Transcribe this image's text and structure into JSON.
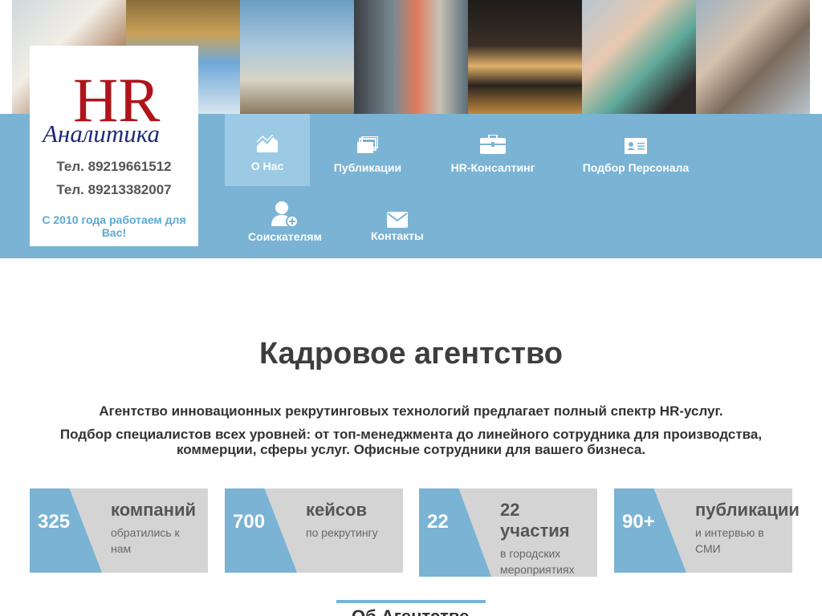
{
  "header": {
    "photos": [
      "office-photo",
      "arch-photo",
      "gate-photo",
      "interview-photo",
      "night-palace-photo",
      "selfie-photo",
      "embankment-photo"
    ]
  },
  "logo": {
    "letters": "HR",
    "word": "Аналитика",
    "brand_color": "#b0131a",
    "script_color": "#1e2b7a"
  },
  "contacts": {
    "phone1": "Тел. 89219661512",
    "phone2": "Тел. 89213382007",
    "since": "С 2010 года работаем для Вас!"
  },
  "nav": {
    "items": [
      {
        "label": "О Нас",
        "icon": "chart-icon",
        "active": true
      },
      {
        "label": "Публикации",
        "icon": "layers-icon"
      },
      {
        "label": "HR-Консалтинг",
        "icon": "briefcase-icon"
      },
      {
        "label": "Подбор Персонала",
        "icon": "id-card-icon"
      },
      {
        "label": "Соискателям",
        "icon": "add-user-icon"
      },
      {
        "label": "Контакты",
        "icon": "envelope-icon"
      }
    ]
  },
  "main": {
    "title": "Кадровое агентство",
    "p1": "Агентство инновационных рекрутинговых технологий предлагает полный спектр HR-услуг.",
    "p2": "Подбор специалистов всех уровней: от топ-менеджмента до линейного сотрудника для производства, коммерции, сферы услуг. Офисные сотрудники для вашего бизнеса."
  },
  "stats": [
    {
      "number": "325",
      "title": "компаний",
      "text": "обратились к нам"
    },
    {
      "number": "700",
      "title": "кейсов",
      "text": "по рекрутингу"
    },
    {
      "number": "22",
      "title": "участия",
      "title_prefix": "22",
      "text": "в городских мероприятиях"
    },
    {
      "number": "90+",
      "title": "публикации",
      "text": "и интервью в СМИ"
    }
  ],
  "bottom": {
    "heading": "Об Агентстве"
  },
  "colors": {
    "accent": "#7ab3d4",
    "accent_light": "#9ccae4",
    "stat_bg": "#d4d4d4",
    "since_text": "#5ba9d3"
  }
}
